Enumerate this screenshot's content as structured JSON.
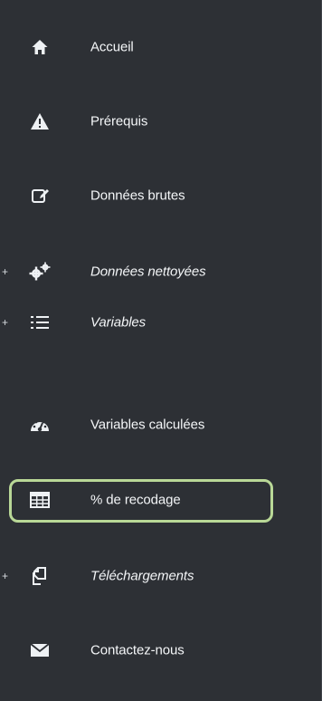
{
  "sidebar": {
    "items": [
      {
        "label": "Accueil",
        "icon": "home-icon",
        "italic": false,
        "expandable": false
      },
      {
        "label": "Prérequis",
        "icon": "warning-icon",
        "italic": false,
        "expandable": false
      },
      {
        "label": "Données brutes",
        "icon": "edit-icon",
        "italic": false,
        "expandable": false
      },
      {
        "label": "Données nettoyées",
        "icon": "gears-icon",
        "italic": true,
        "expandable": true,
        "toggle": "+"
      },
      {
        "label": "Variables",
        "icon": "list-icon",
        "italic": true,
        "expandable": true,
        "toggle": "+"
      },
      {
        "label": "Variables calculées",
        "icon": "dashboard-icon",
        "italic": false,
        "expandable": false
      },
      {
        "label": "% de recodage",
        "icon": "table-icon",
        "italic": false,
        "expandable": false,
        "active": true
      },
      {
        "label": "Téléchargements",
        "icon": "copy-icon",
        "italic": true,
        "expandable": true,
        "toggle": "+"
      },
      {
        "label": "Contactez-nous",
        "icon": "envelope-icon",
        "italic": false,
        "expandable": false
      }
    ],
    "highlight_color": "#b9d897"
  }
}
